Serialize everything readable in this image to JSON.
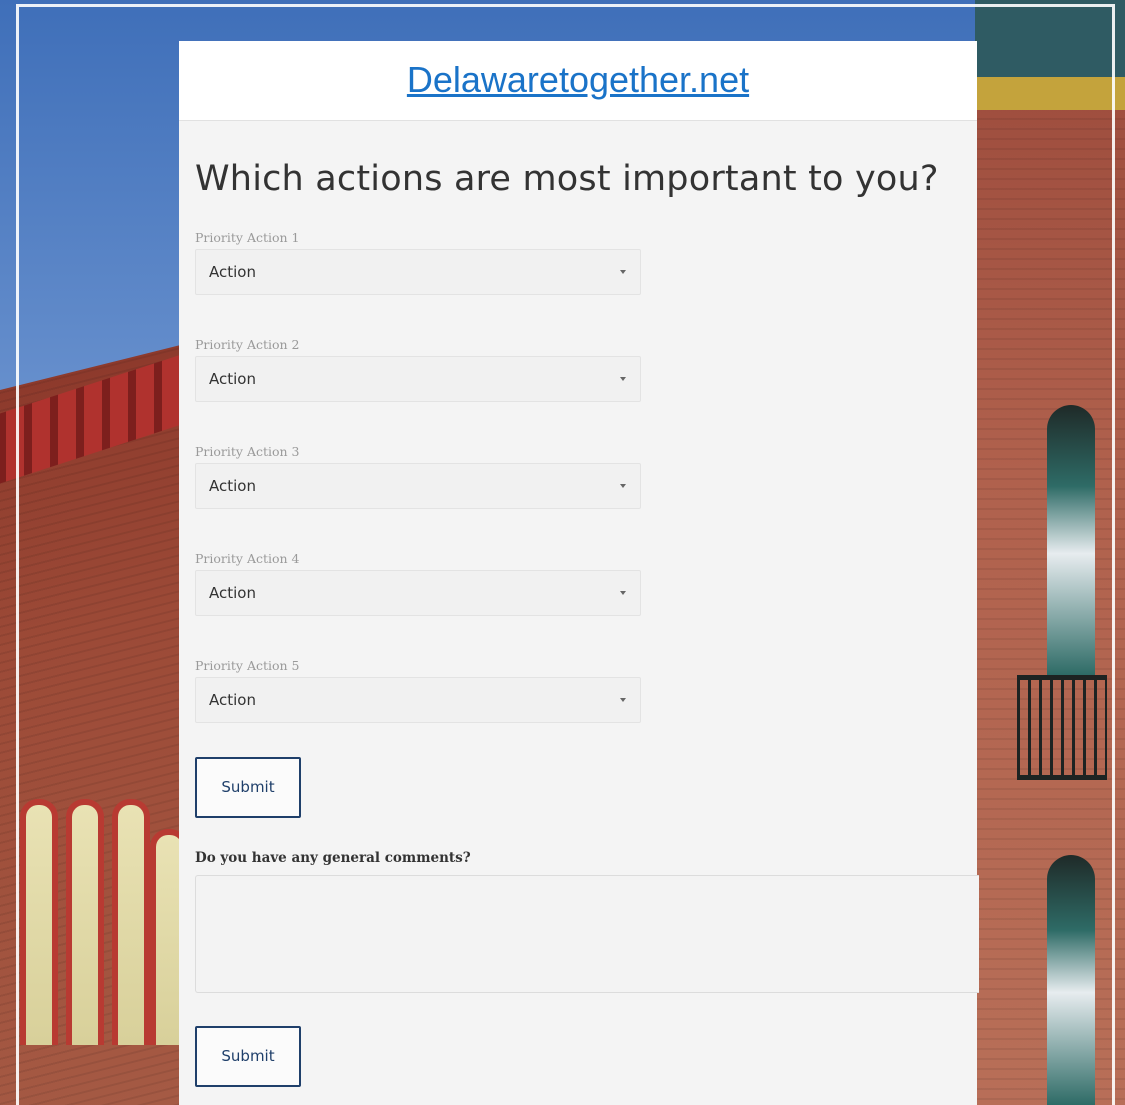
{
  "site": {
    "link_text": "Delawaretogether.net"
  },
  "form": {
    "title": "Which actions are most important to you?",
    "priority_fields": [
      {
        "label": "Priority Action 1",
        "value": "Action"
      },
      {
        "label": "Priority Action 2",
        "value": "Action"
      },
      {
        "label": "Priority Action 3",
        "value": "Action"
      },
      {
        "label": "Priority Action 4",
        "value": "Action"
      },
      {
        "label": "Priority Action 5",
        "value": "Action"
      }
    ],
    "submit_label_1": "Submit",
    "comments_label": "Do you have any general comments?",
    "comments_value": "",
    "submit_label_2": "Submit"
  },
  "icons": {
    "dropdown": "chevron-down-icon"
  },
  "colors": {
    "link": "#1a73c8",
    "button_border": "#1f3f6a",
    "panel_bg": "#f4f4f4"
  }
}
